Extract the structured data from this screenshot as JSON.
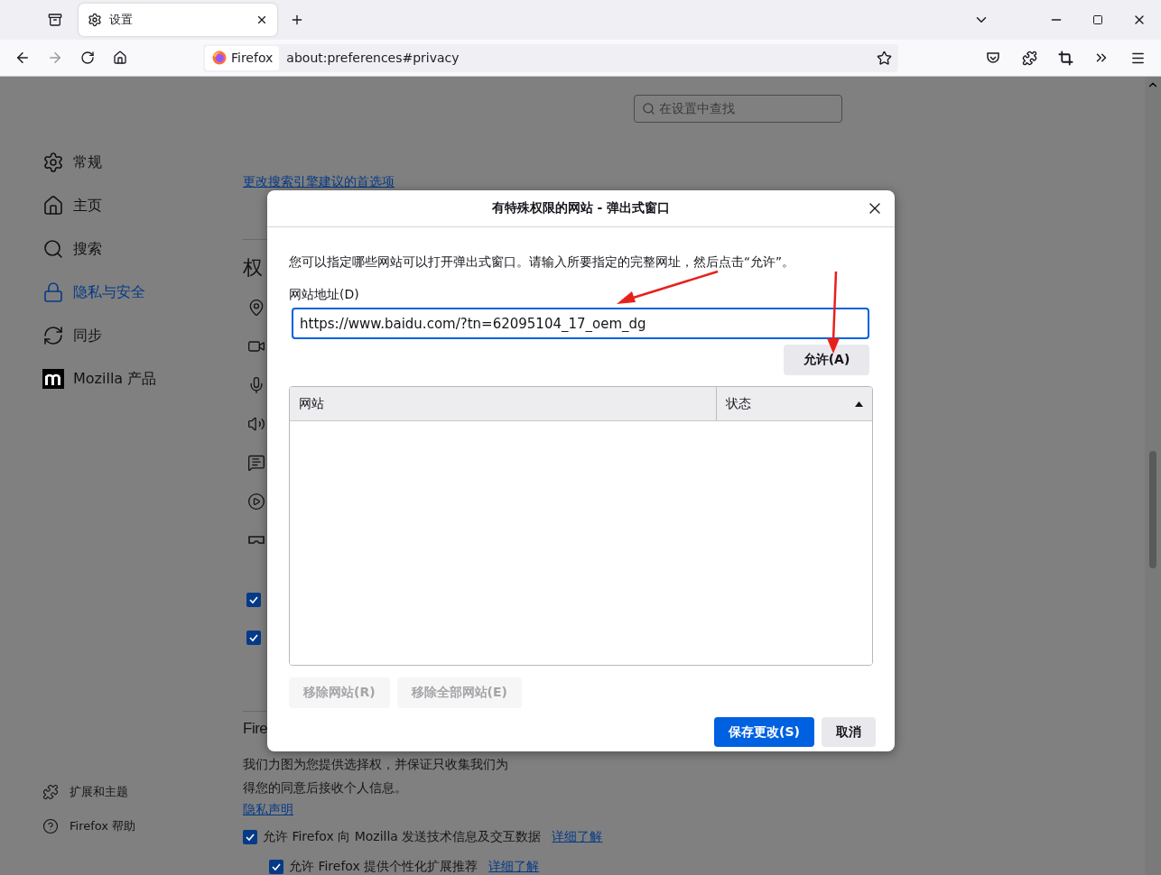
{
  "browser": {
    "tabs": [
      {
        "label": "设置",
        "selected": true
      }
    ],
    "identity": "Firefox",
    "url": "about:preferences#privacy"
  },
  "settings_search": {
    "placeholder": "在设置中查找"
  },
  "sidebar": {
    "items": [
      {
        "label": "常规",
        "selected": false
      },
      {
        "label": "主页",
        "selected": false
      },
      {
        "label": "搜索",
        "selected": false
      },
      {
        "label": "隐私与安全",
        "selected": true
      },
      {
        "label": "同步",
        "selected": false
      },
      {
        "label": "Mozilla 产品",
        "selected": false
      }
    ],
    "footer": [
      {
        "label": "扩展和主题"
      },
      {
        "label": "Firefox 帮助"
      }
    ]
  },
  "main": {
    "search_link": "更改搜索引擎建议的首选项",
    "permissions_heading": "权",
    "permission_checks": [
      {
        "checked": true
      },
      {
        "checked": true
      }
    ],
    "section_heading": "Fire",
    "paragraph": [
      "我们力图为您提供选择权，并保证只收集我们为",
      "得您的同意后接收个人信息。"
    ],
    "privacy_link": "隐私声明",
    "options": [
      {
        "label": "允许 Firefox 向 Mozilla 发送技术信息及交互数据",
        "link": "详细了解",
        "checked": true,
        "nested": false
      },
      {
        "label": "允许 Firefox 提供个性化扩展推荐",
        "link": "详细了解",
        "checked": true,
        "nested": true
      }
    ]
  },
  "dialog": {
    "title": "有特殊权限的网站 - 弹出式窗口",
    "description": "您可以指定哪些网站可以打开弹出式窗口。请输入所要指定的完整网址，然后点击“允许”。",
    "address_label": "网站地址(D)",
    "address_value": "https://www.baidu.com/?tn=62095104_17_oem_dg",
    "allow_button": "允许(A)",
    "columns": [
      {
        "label": "网站",
        "sorted": false
      },
      {
        "label": "状态",
        "sorted": true
      }
    ],
    "remove_buttons": [
      {
        "label": "移除网站(R)",
        "disabled": true
      },
      {
        "label": "移除全部网站(E)",
        "disabled": true
      }
    ],
    "footer_buttons": [
      {
        "label": "保存更改(S)",
        "kind": "primary"
      },
      {
        "label": "取消",
        "kind": "secondary"
      }
    ]
  }
}
